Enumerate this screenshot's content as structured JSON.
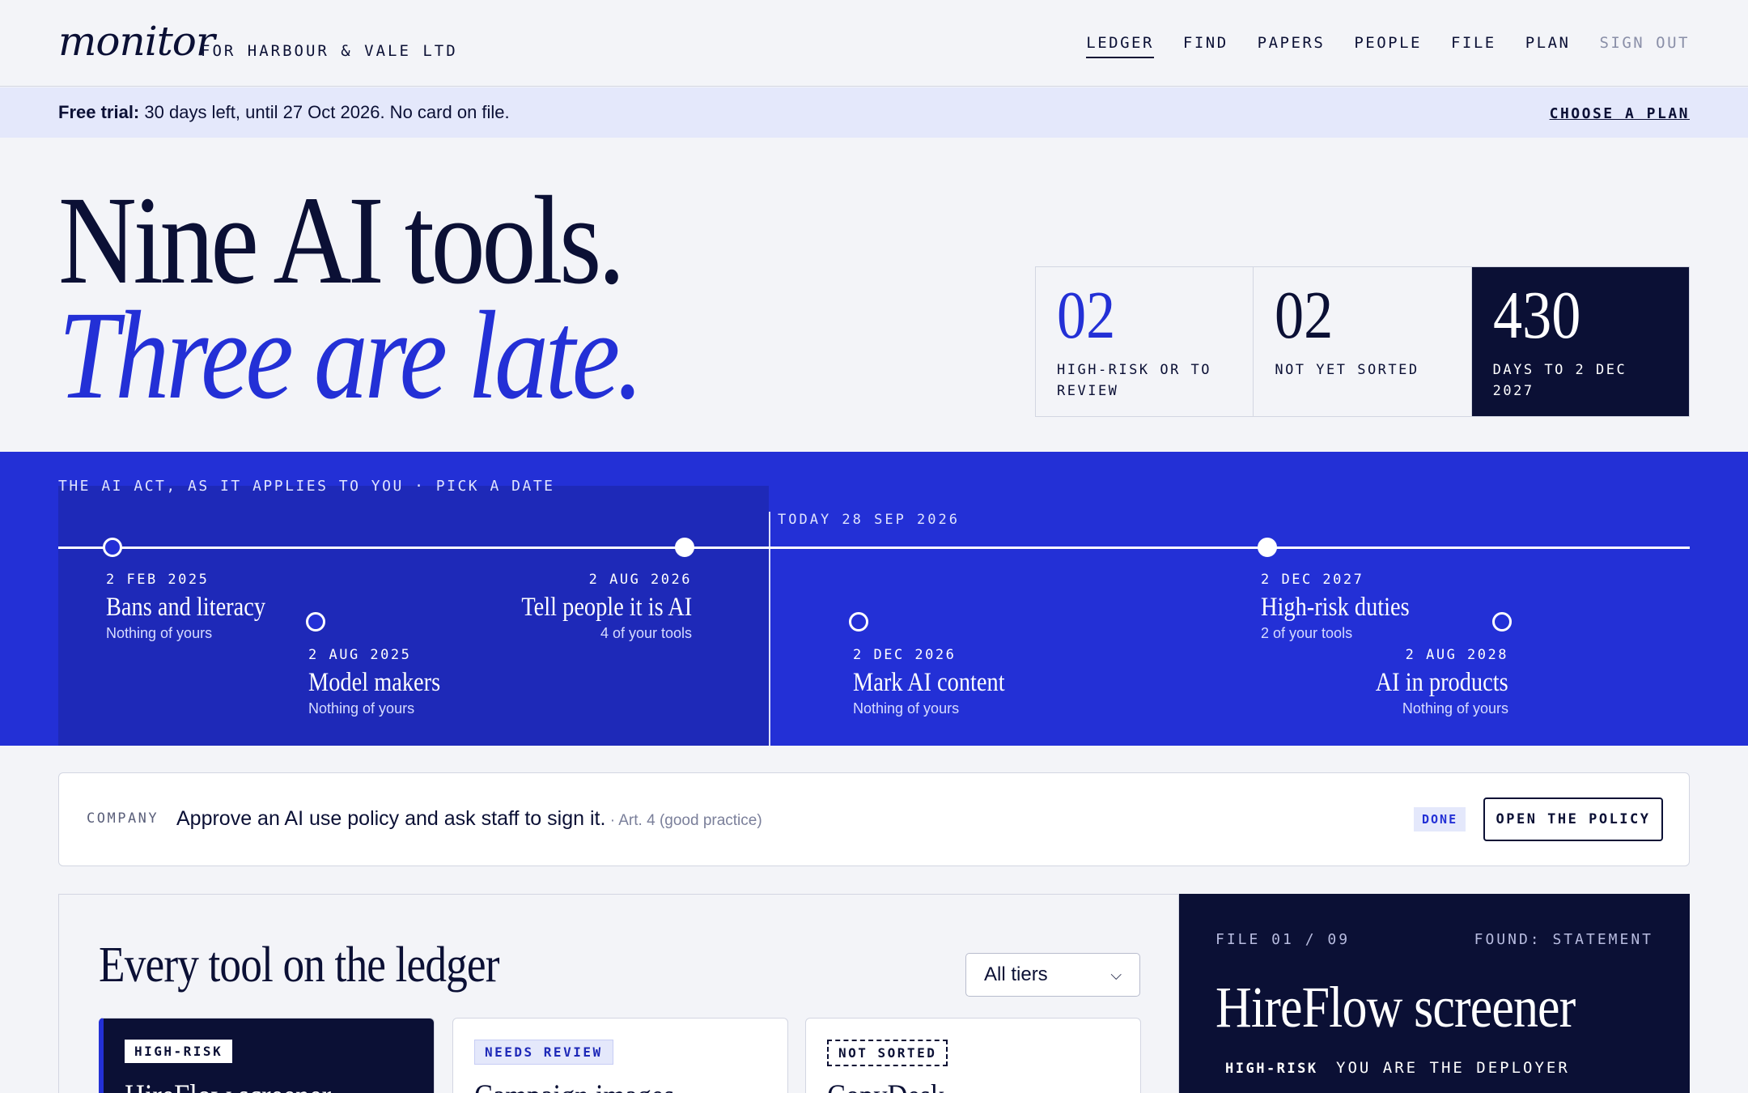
{
  "header": {
    "brand": "monitor",
    "company": "FOR HARBOUR & VALE LTD",
    "nav": [
      {
        "label": "LEDGER",
        "active": true
      },
      {
        "label": "FIND"
      },
      {
        "label": "PAPERS"
      },
      {
        "label": "PEOPLE"
      },
      {
        "label": "FILE"
      },
      {
        "label": "PLAN"
      },
      {
        "label": "SIGN OUT",
        "muted": true
      }
    ]
  },
  "trial": {
    "strong": "Free trial:",
    "text": "30 days left, until 27 Oct 2026. No card on file.",
    "link": "CHOOSE A PLAN"
  },
  "hero": {
    "line1": "Nine AI tools.",
    "line2": "Three are late."
  },
  "stats": [
    {
      "num": "02",
      "label": "HIGH-RISK OR TO REVIEW"
    },
    {
      "num": "02",
      "label": "NOT YET SORTED"
    },
    {
      "num": "430",
      "label": "DAYS TO 2 DEC 2027"
    }
  ],
  "timeline": {
    "title": "THE AI ACT, AS IT APPLIES TO YOU · PICK A DATE",
    "today": "TODAY 28 SEP 2026",
    "events": [
      {
        "date": "2 FEB 2025",
        "title": "Bans and literacy",
        "sub": "Nothing of yours"
      },
      {
        "date": "2 AUG 2025",
        "title": "Model makers",
        "sub": "Nothing of yours"
      },
      {
        "date": "2 AUG 2026",
        "title": "Tell people it is AI",
        "sub": "4 of your tools"
      },
      {
        "date": "2 DEC 2026",
        "title": "Mark AI content",
        "sub": "Nothing of yours"
      },
      {
        "date": "2 DEC 2027",
        "title": "High-risk duties",
        "sub": "2 of your tools"
      },
      {
        "date": "2 AUG 2028",
        "title": "AI in products",
        "sub": "Nothing of yours"
      }
    ]
  },
  "task": {
    "category": "COMPANY",
    "text": "Approve an AI use policy and ask staff to sign it.",
    "note": " · Art. 4 (good practice)",
    "status": "DONE",
    "button": "OPEN THE POLICY"
  },
  "ledger": {
    "title": "Every tool on the ledger",
    "filter": "All tiers",
    "cards": [
      {
        "badge": "HIGH-RISK",
        "title": "HireFlow screener"
      },
      {
        "badge": "NEEDS REVIEW",
        "title": "Campaign images"
      },
      {
        "badge": "NOT SORTED",
        "title": "CopyDesk"
      }
    ]
  },
  "file": {
    "number": "FILE 01 / 09",
    "found": "FOUND: STATEMENT",
    "title": "HireFlow screener",
    "badge": "HIGH-RISK",
    "role": "YOU ARE THE DEPLOYER"
  },
  "colors": {
    "navy": "#0b1035",
    "accent": "#2330d6",
    "background": "#f3f4f8",
    "trial_bg": "#e4e8fb"
  }
}
